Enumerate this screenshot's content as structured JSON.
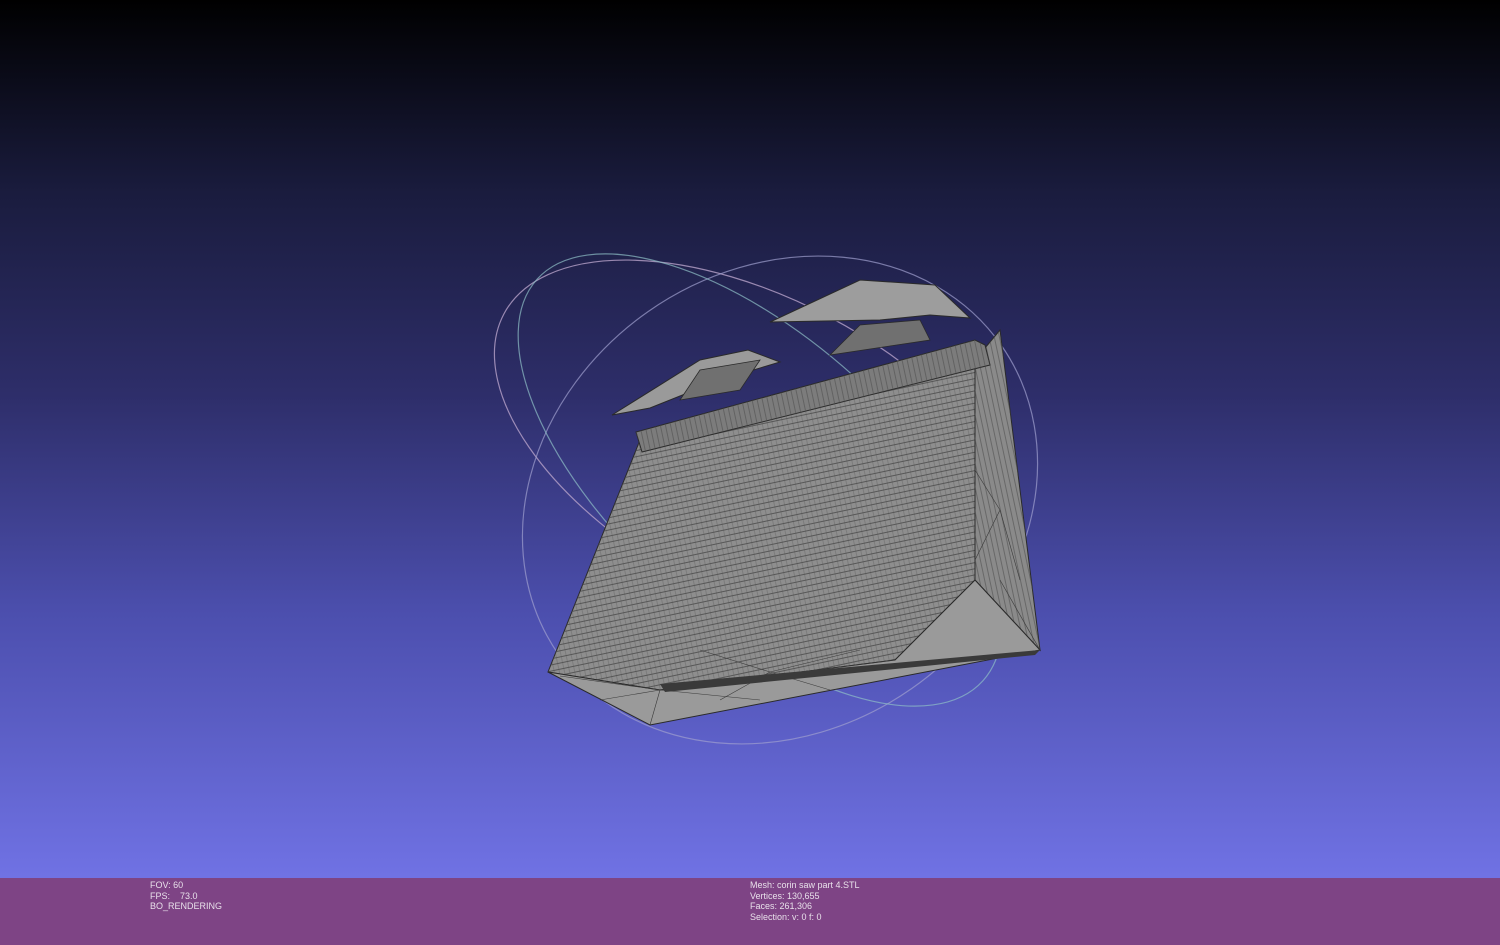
{
  "status": {
    "fov": "FOV: 60",
    "fps": "FPS:    73.0",
    "render_mode": "BO_RENDERING",
    "mesh": "Mesh: corin saw part 4.STL",
    "vertices": "Vertices: 130,655",
    "faces": "Faces: 261,306",
    "selection": "Selection: v: 0 f: 0"
  },
  "colors": {
    "status_bar": "#7e4485",
    "mesh_fill": "#8e8e8e",
    "mesh_wire": "#3a3a3a",
    "bg_top": "#000000",
    "bg_bottom": "#7072e4"
  },
  "icons": {
    "trackball": "trackball-icon",
    "mesh": "mesh-model"
  }
}
